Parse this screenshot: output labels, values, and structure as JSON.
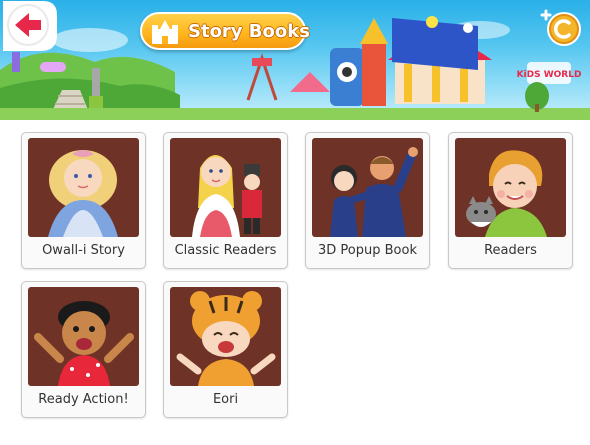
{
  "header": {
    "title": "Story Books",
    "back_icon": "back-arrow-icon",
    "title_icon": "castle-icon",
    "coin_icon": "coin-add-icon",
    "brand_sign": "KiDS WORLD"
  },
  "books": [
    {
      "label": "Owall-i Story",
      "icon": "princess-illustration"
    },
    {
      "label": "Classic Readers",
      "icon": "girl-with-nutcracker-illustration"
    },
    {
      "label": "3D Popup Book",
      "icon": "dancing-couple-illustration"
    },
    {
      "label": "Readers",
      "icon": "boy-with-cat-illustration"
    },
    {
      "label": "Ready Action!",
      "icon": "cheering-kid-illustration"
    },
    {
      "label": "Eori",
      "icon": "tiger-costume-kid-illustration"
    }
  ],
  "colors": {
    "sky": "#2ab0e8",
    "title_pill": "#ffb41c",
    "thumb_bg": "#6e3326",
    "back_arrow": "#e8284a"
  }
}
